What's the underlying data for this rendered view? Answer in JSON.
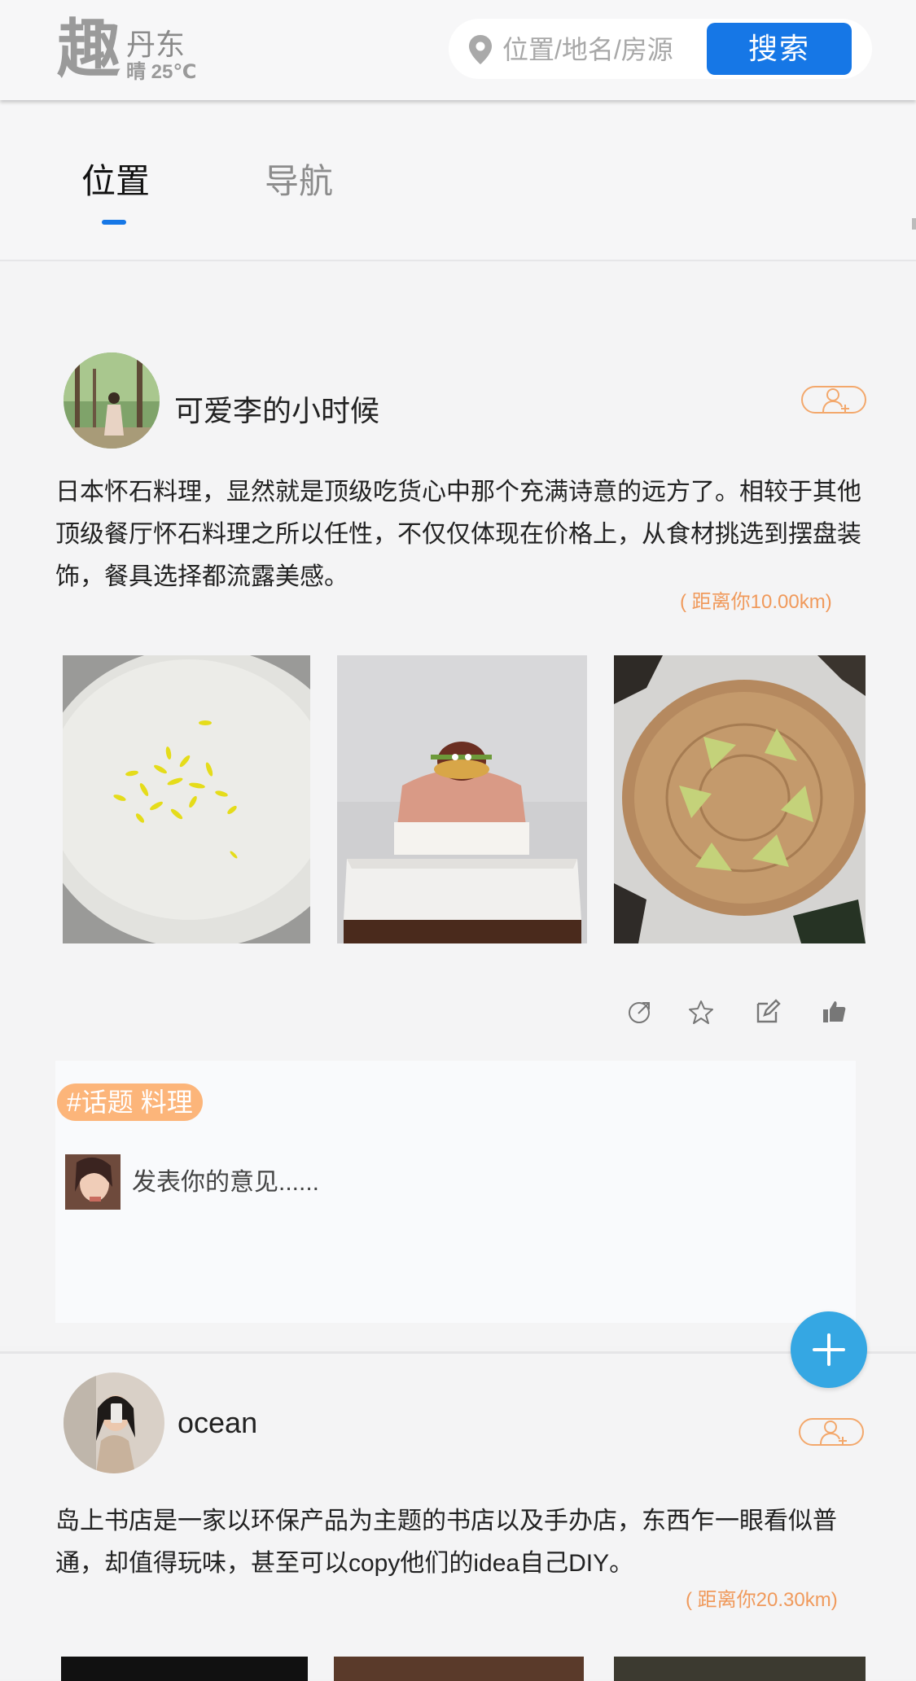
{
  "header": {
    "logo": "趣",
    "city": "丹东",
    "weather": "晴 25℃",
    "search_placeholder": "位置/地名/房源",
    "search_button": "搜索"
  },
  "tabs": [
    {
      "label": "位置",
      "active": true
    },
    {
      "label": "导航",
      "active": false
    }
  ],
  "posts": [
    {
      "username": "可爱李的小时候",
      "text": "日本怀石料理，显然就是顶级吃货心中那个充满诗意的远方了。相较于其他顶级餐厅怀石料理之所以任性，不仅仅体现在价格上，从食材挑选到摆盘装饰，餐具选择都流露美感。",
      "distance": "( 距离你10.00km)",
      "photos": [
        "plate-with-petals",
        "sushi-on-ice",
        "wood-board-avocado"
      ],
      "actions": [
        "share-icon",
        "star-icon",
        "edit-icon",
        "thumbs-up-icon"
      ],
      "topic_tag": "#话题 料理",
      "comment_placeholder": "发表你的意见......"
    },
    {
      "username": "ocean",
      "text": "岛上书店是一家以环保产品为主题的书店以及手办店，东西乍一眼看似普通，却值得玩味，甚至可以copy他们的idea自己DIY。",
      "distance": "( 距离你20.30km)"
    }
  ],
  "colors": {
    "accent": "#1677e6",
    "fab": "#35a7e3",
    "distance": "#f09a5c",
    "topic_tag": "#fcb57a"
  }
}
